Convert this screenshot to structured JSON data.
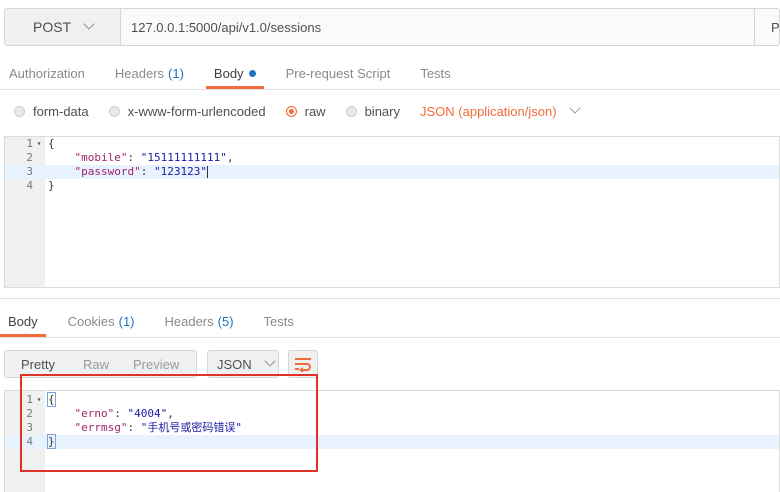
{
  "request": {
    "method": "POST",
    "url": "127.0.0.1:5000/api/v1.0/sessions",
    "params_label": "Params",
    "tabs": [
      {
        "label": "Authorization",
        "count": ""
      },
      {
        "label": "Headers",
        "count": "(1)"
      },
      {
        "label": "Body",
        "count": ""
      },
      {
        "label": "Pre-request Script",
        "count": ""
      },
      {
        "label": "Tests",
        "count": ""
      }
    ],
    "active_tab": "Body",
    "body_types": [
      "form-data",
      "x-www-form-urlencoded",
      "raw",
      "binary"
    ],
    "selected_body_type": "raw",
    "content_type": "JSON (application/json)",
    "editor_lines": [
      {
        "n": "1",
        "fold": "▾",
        "code": "{"
      },
      {
        "n": "2",
        "fold": "",
        "key": "\"mobile\"",
        "sep": ": ",
        "val": "\"15111111111\"",
        "tail": ","
      },
      {
        "n": "3",
        "fold": "",
        "key": "\"password\"",
        "sep": ": ",
        "val": "\"123123\"",
        "tail": ""
      },
      {
        "n": "4",
        "fold": "",
        "code": "}"
      }
    ]
  },
  "response": {
    "tabs": [
      {
        "label": "Body",
        "count": ""
      },
      {
        "label": "Cookies",
        "count": "(1)"
      },
      {
        "label": "Headers",
        "count": "(5)"
      },
      {
        "label": "Tests",
        "count": ""
      }
    ],
    "active_tab": "Body",
    "view_modes": [
      "Pretty",
      "Raw",
      "Preview"
    ],
    "format": "JSON",
    "editor_lines": [
      {
        "n": "1",
        "fold": "▾",
        "code": "{"
      },
      {
        "n": "2",
        "fold": "",
        "key": "\"erno\"",
        "sep": ": ",
        "val": "\"4004\"",
        "tail": ","
      },
      {
        "n": "3",
        "fold": "",
        "key": "\"errmsg\"",
        "sep": ": ",
        "val": "\"手机号或密码错误\"",
        "tail": ""
      },
      {
        "n": "4",
        "fold": "",
        "code": "}"
      }
    ]
  },
  "colors": {
    "accent": "#f26b3a",
    "count_blue": "#1c75c4",
    "json_key": "#a0236a",
    "json_string": "#1a1aa6",
    "annotation": "#e0312b"
  }
}
